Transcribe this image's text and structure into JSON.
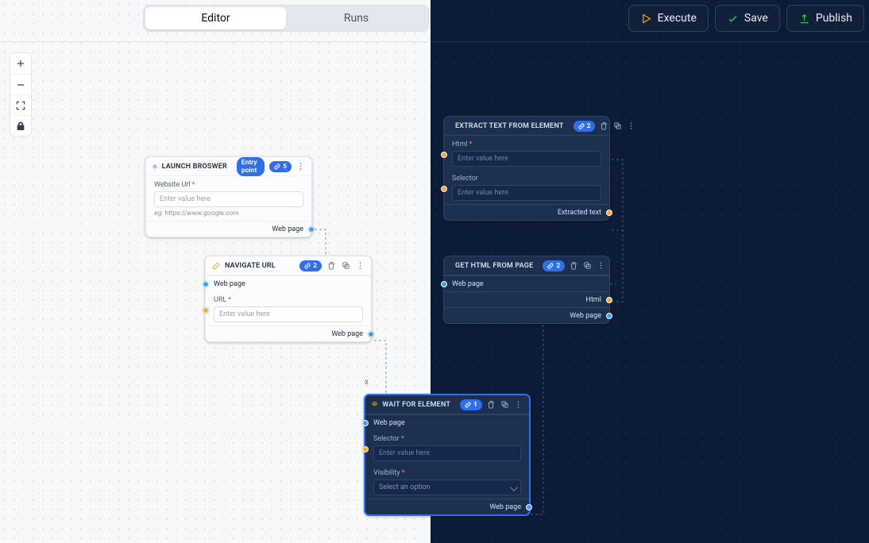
{
  "toolbar": {
    "tabs": {
      "editor": "Editor",
      "runs": "Runs"
    },
    "execute": "Execute",
    "save": "Save",
    "publish": "Publish"
  },
  "nodes": {
    "launch": {
      "title": "LAUNCH BROSWER",
      "entry_badge": "Entry point",
      "count_badge": "5",
      "url_label": "Website Url",
      "url_placeholder": "Enter value here",
      "url_hint": "eg: https://www.google.com",
      "out_webpage": "Web page"
    },
    "navigate": {
      "title": "NAVIGATE URL",
      "count_badge": "2",
      "in_webpage": "Web page",
      "url_label": "URL",
      "url_placeholder": "Enter value here",
      "out_webpage": "Web page"
    },
    "wait": {
      "title": "WAIT FOR ELEMENT",
      "count_badge": "1",
      "in_webpage": "Web page",
      "selector_label": "Selector",
      "selector_placeholder": "Enter value here",
      "visibility_label": "Visibility",
      "visibility_placeholder": "Select an option",
      "out_webpage": "Web page"
    },
    "extract": {
      "title": "EXTRACT TEXT FROM ELEMENT",
      "count_badge": "2",
      "html_label": "Html",
      "html_placeholder": "Enter value here",
      "selector_label": "Selector",
      "selector_placeholder": "Enter value here",
      "out_text": "Extracted text"
    },
    "gethtml": {
      "title": "GET HTML FROM PAGE",
      "count_badge": "2",
      "in_webpage": "Web page",
      "out_html": "Html",
      "out_webpage": "Web page"
    }
  },
  "misc": {
    "x": "x"
  }
}
